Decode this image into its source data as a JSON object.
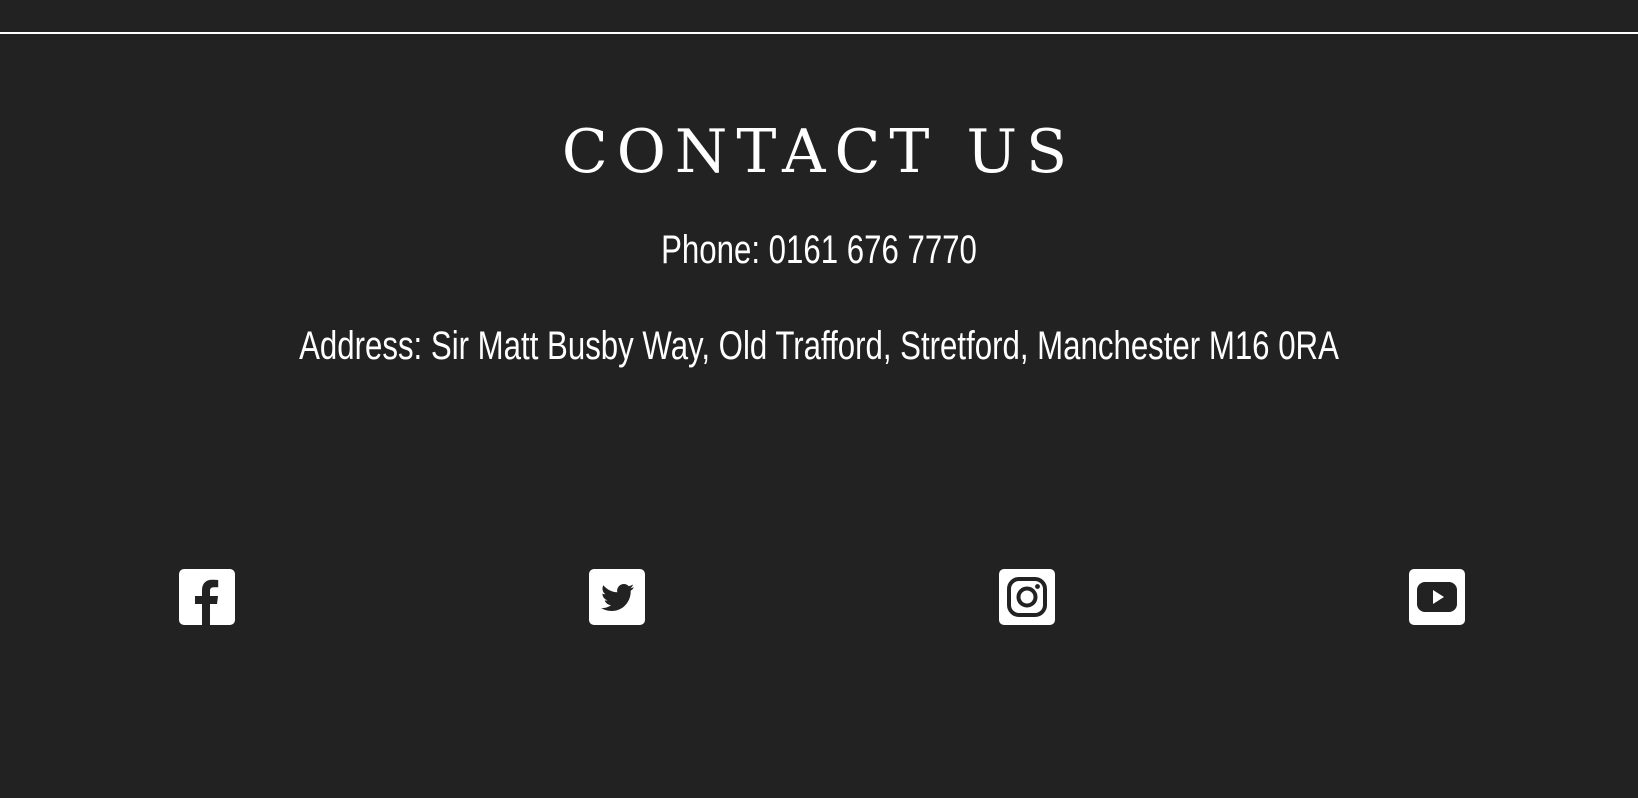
{
  "contact": {
    "title": "CONTACT US",
    "phone": "Phone: 0161 676 7770",
    "address": "Address: Sir Matt Busby Way, Old Trafford, Stretford, Manchester M16 0RA"
  },
  "social": {
    "icons": [
      "facebook-icon",
      "twitter-icon",
      "instagram-icon",
      "youtube-icon"
    ]
  },
  "colors": {
    "background": "#222222",
    "foreground": "#ffffff"
  }
}
